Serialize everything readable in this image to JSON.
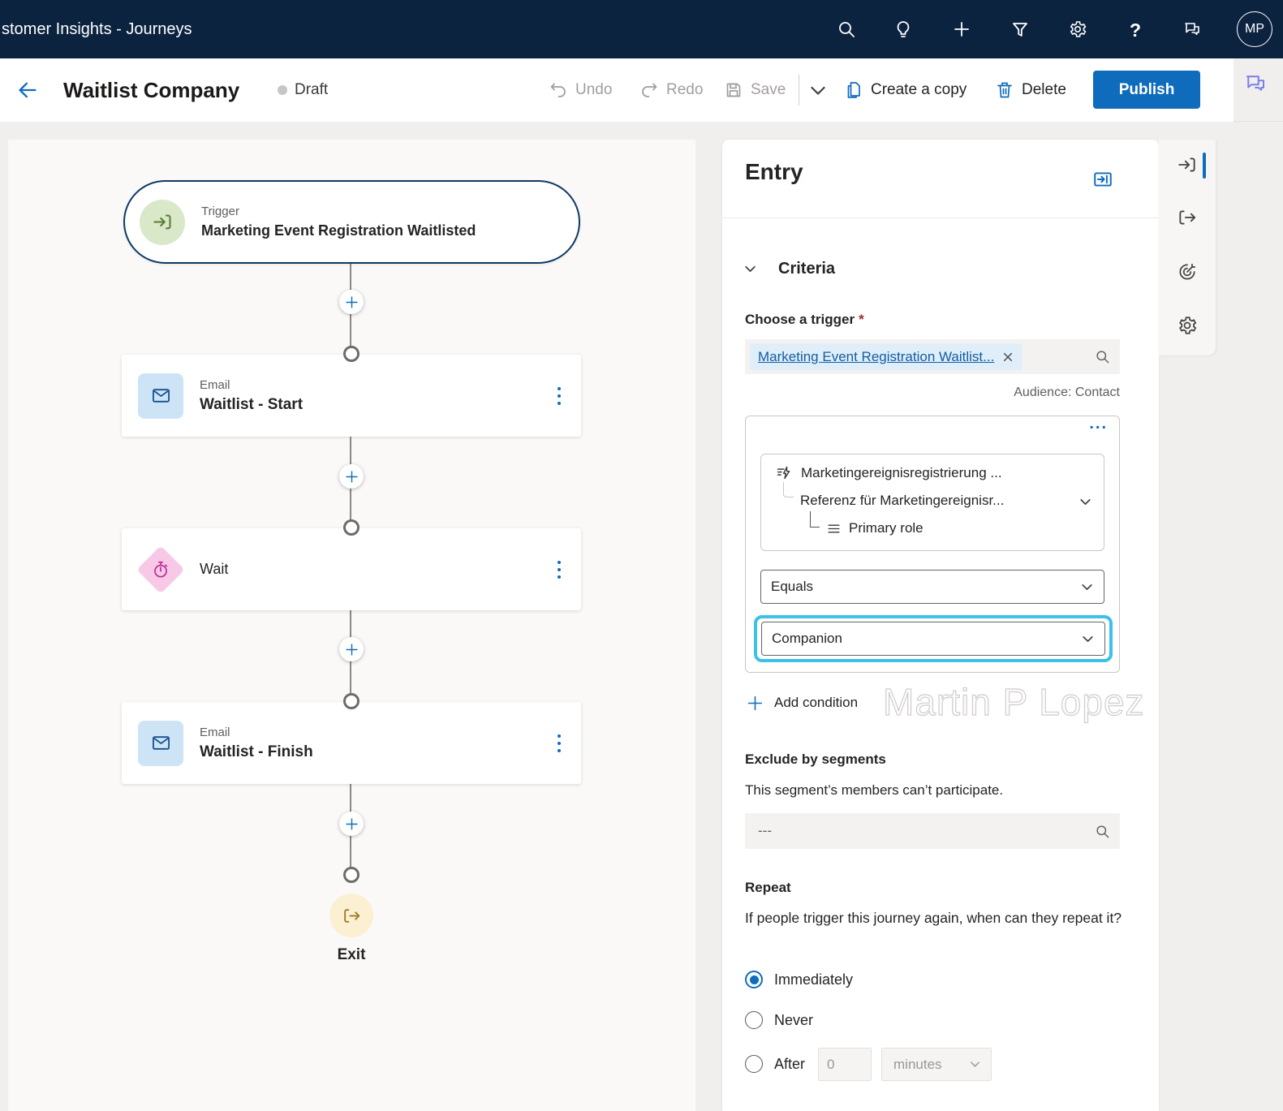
{
  "topbar": {
    "app_title": "stomer Insights - Journeys",
    "avatar_initials": "MP"
  },
  "toolbar": {
    "journey_title": "Waitlist Company",
    "status": "Draft",
    "undo_label": "Undo",
    "redo_label": "Redo",
    "save_label": "Save",
    "create_copy_label": "Create a copy",
    "delete_label": "Delete",
    "publish_label": "Publish"
  },
  "canvas": {
    "trigger_type": "Trigger",
    "trigger_title": "Marketing Event Registration Waitlisted",
    "email1_type": "Email",
    "email1_title": "Waitlist - Start",
    "wait_label": "Wait",
    "email2_type": "Email",
    "email2_title": "Waitlist - Finish",
    "exit_label": "Exit"
  },
  "panel": {
    "title": "Entry",
    "criteria_label": "Criteria",
    "choose_trigger_label": "Choose a trigger",
    "required_mark": "*",
    "trigger_chip": "Marketing Event Registration Waitlist...",
    "audience": "Audience: Contact",
    "condition": {
      "menu": "...",
      "root": "Marketingereignisregistrierung ...",
      "reference": "Referenz für Marketingereignisr...",
      "leaf": "Primary role",
      "operator": "Equals",
      "value": "Companion"
    },
    "add_condition_label": "Add condition",
    "exclude": {
      "title": "Exclude by segments",
      "description": "This segment’s members can’t participate.",
      "placeholder": "---"
    },
    "repeat": {
      "title": "Repeat",
      "question": "If people trigger this journey again, when can they repeat it?",
      "immediately": "Immediately",
      "never": "Never",
      "after": "After",
      "after_value": "0",
      "after_unit": "minutes"
    }
  },
  "watermark": {
    "text": "Martin P Lopez"
  },
  "colors": {
    "accent": "#0F6CBD",
    "header_bg": "#0C2340",
    "publish_button": "#0F6CBD",
    "selection_highlight": "#3CC1E7",
    "link": "#115EA3",
    "trigger_border": "#0E3A66"
  }
}
